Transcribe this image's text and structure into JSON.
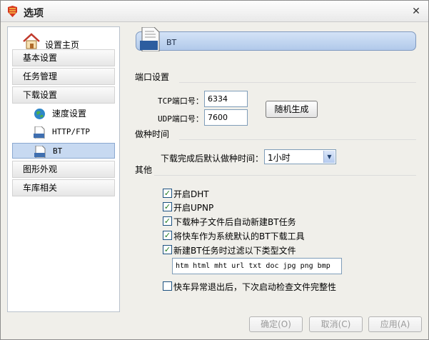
{
  "window": {
    "title": "选项"
  },
  "sidebar": {
    "home": "设置主页",
    "items": [
      {
        "label": "基本设置"
      },
      {
        "label": "任务管理"
      },
      {
        "label": "下载设置"
      }
    ],
    "sub_items": [
      {
        "label": "速度设置",
        "icon": "globe-icon"
      },
      {
        "label": "HTTP/FTP",
        "icon": "http-icon"
      },
      {
        "label": "BT",
        "icon": "bt-icon"
      }
    ],
    "items_after": [
      {
        "label": "图形外观"
      },
      {
        "label": "车库相关"
      }
    ]
  },
  "header": {
    "label": "BT"
  },
  "port": {
    "section": "端口设置",
    "tcp_label": "TCP端口号：",
    "tcp_value": "6334",
    "udp_label": "UDP端口号：",
    "udp_value": "7600",
    "random_button": "随机生成"
  },
  "seeding": {
    "section": "做种时间",
    "label": "下载完成后默认做种时间：",
    "value": "1小时"
  },
  "other": {
    "section": "其他",
    "options": [
      {
        "label": "开启DHT",
        "checked": true
      },
      {
        "label": "开启UPNP",
        "checked": true
      },
      {
        "label": "下载种子文件后自动新建BT任务",
        "checked": true
      },
      {
        "label": "将快车作为系统默认的BT下载工具",
        "checked": true
      },
      {
        "label": "新建BT任务时过滤以下类型文件",
        "checked": true
      }
    ],
    "filter_value": "htm html mht url txt doc jpg png bmp",
    "integrity_label": "快车异常退出后，下次启动检查文件完整性",
    "integrity_checked": false
  },
  "footer": {
    "ok": "确定(O)",
    "cancel": "取消(C)",
    "apply": "应用(A)"
  }
}
